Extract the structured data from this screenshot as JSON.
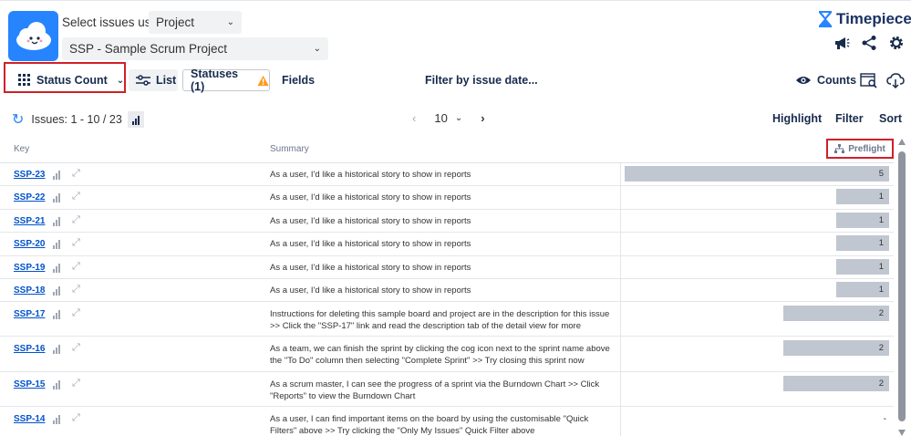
{
  "header": {
    "select_label": "Select issues using",
    "selector_type": "Project",
    "project": "SSP - Sample Scrum Project",
    "brand": "Timepiece",
    "brand_color": "#1a3263",
    "logo_color": "#2684ff"
  },
  "toolbar": {
    "view": "Status Count",
    "list": "List",
    "statuses": "Statuses (1)",
    "fields": "Fields",
    "filter_by_date": "Filter by issue date...",
    "counts": "Counts",
    "highlight_color": "#d0202a"
  },
  "issues_bar": {
    "range": "Issues: 1 - 10 / 23",
    "page_size": "10",
    "highlight": "Highlight",
    "filter": "Filter",
    "sort": "Sort"
  },
  "table": {
    "columns": {
      "key": "Key",
      "summary": "Summary",
      "preflight": "Preflight"
    },
    "rows": [
      {
        "key": "SSP-23",
        "summary": "As a user, I'd like a historical story to show in reports",
        "preflight": "5",
        "value": 5
      },
      {
        "key": "SSP-22",
        "summary": "As a user, I'd like a historical story to show in reports",
        "preflight": "1",
        "value": 1
      },
      {
        "key": "SSP-21",
        "summary": "As a user, I'd like a historical story to show in reports",
        "preflight": "1",
        "value": 1
      },
      {
        "key": "SSP-20",
        "summary": "As a user, I'd like a historical story to show in reports",
        "preflight": "1",
        "value": 1
      },
      {
        "key": "SSP-19",
        "summary": "As a user, I'd like a historical story to show in reports",
        "preflight": "1",
        "value": 1
      },
      {
        "key": "SSP-18",
        "summary": "As a user, I'd like a historical story to show in reports",
        "preflight": "1",
        "value": 1
      },
      {
        "key": "SSP-17",
        "summary": "Instructions for deleting this sample board and project are in the description for this issue >> Click the \"SSP-17\" link and read the description tab of the detail view for more",
        "preflight": "2",
        "value": 2
      },
      {
        "key": "SSP-16",
        "summary": "As a team, we can finish the sprint by clicking the cog icon next to the sprint name above the \"To Do\" column then selecting \"Complete Sprint\" >> Try closing this sprint now",
        "preflight": "2",
        "value": 2
      },
      {
        "key": "SSP-15",
        "summary": "As a scrum master, I can see the progress of a sprint via the Burndown Chart >> Click \"Reports\" to view the Burndown Chart",
        "preflight": "2",
        "value": 2
      },
      {
        "key": "SSP-14",
        "summary": "As a user, I can find important items on the board by using the customisable \"Quick Filters\" above >> Try clicking the \"Only My Issues\" Quick Filter above",
        "preflight": "-",
        "value": 0
      }
    ]
  }
}
